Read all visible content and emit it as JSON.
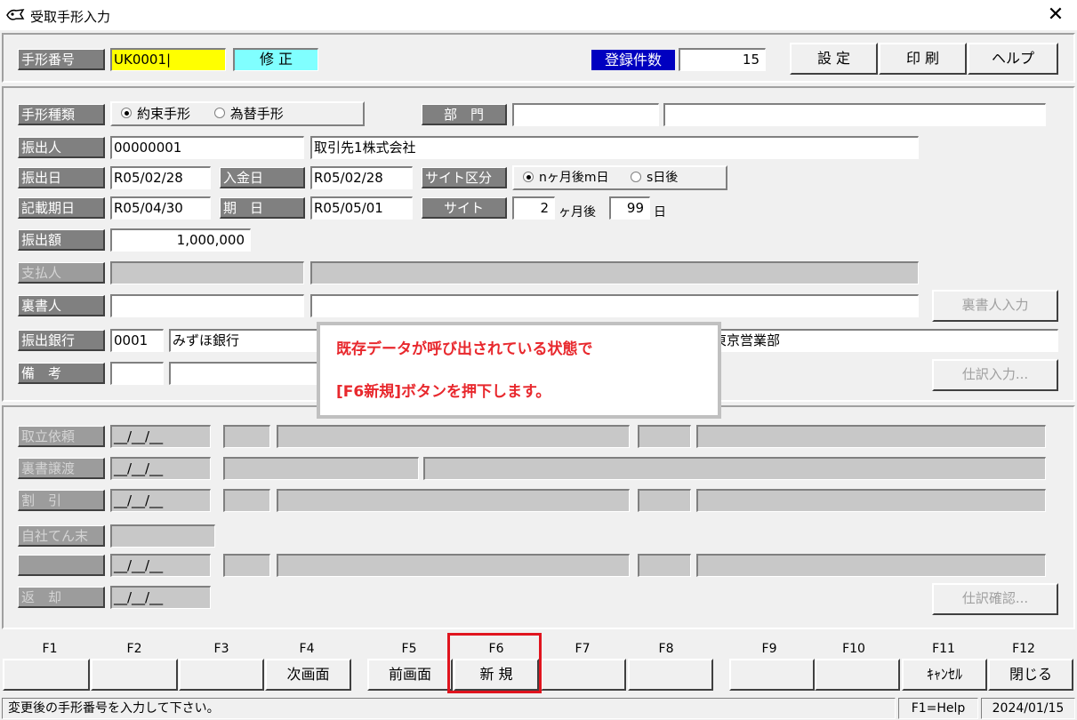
{
  "window": {
    "title": "受取手形入力",
    "icon": "app-icon",
    "close": "✕"
  },
  "header": {
    "note_no_label": "手形番号",
    "note_no_value": "UK0001|",
    "mode_badge": "修 正",
    "count_label": "登録件数",
    "count_value": "15",
    "buttons": {
      "settings": "設 定",
      "print": "印 刷",
      "help": "ヘルプ"
    }
  },
  "form": {
    "type_label": "手形種類",
    "type_options": [
      "約束手形",
      "為替手形"
    ],
    "type_selected": "約束手形",
    "dept_label": "部　門",
    "dept_code": "",
    "dept_name": "",
    "drawer_label": "振出人",
    "drawer_code": "00000001",
    "drawer_name": "取引先1株式会社",
    "issue_date_label": "振出日",
    "issue_date": "R05/02/28",
    "receipt_date_label": "入金日",
    "receipt_date": "R05/02/28",
    "site_type_label": "サイト区分",
    "site_options": [
      "nヶ月後m日",
      "s日後"
    ],
    "site_selected": "nヶ月後m日",
    "entry_date_label": "記載期日",
    "entry_date": "R05/04/30",
    "due_date_label": "期　日",
    "due_date": "R05/05/01",
    "site_label": "サイト",
    "site_months": "2",
    "site_months_unit": "ヶ月後",
    "site_days": "99",
    "site_days_unit": "日",
    "amount_label": "振出額",
    "amount": "1,000,000",
    "payer_label": "支払人",
    "endorser_label": "裏書人",
    "endorser_button": "裏書人入力",
    "bank_label": "振出銀行",
    "bank_code": "0001",
    "bank_name": "みずほ銀行",
    "branch_name": "東京営業部",
    "memo_label": "備　考",
    "journal_button": "仕訳入力..."
  },
  "lower": {
    "rows": [
      "取立依頼",
      "裏書譲渡",
      "割　引",
      "自社てん末",
      "",
      "返　却"
    ],
    "date_placeholder": "__/__/__",
    "journal_check_button": "仕訳確認..."
  },
  "annotation": {
    "line1": "既存データが呼び出されている状態で",
    "line2": "[F6新規]ボタンを押下します。",
    "color": "#e8282d"
  },
  "fkeys": [
    {
      "key": "F1",
      "label": ""
    },
    {
      "key": "F2",
      "label": ""
    },
    {
      "key": "F3",
      "label": ""
    },
    {
      "key": "F4",
      "label": "次画面"
    },
    {
      "key": "F5",
      "label": "前画面"
    },
    {
      "key": "F6",
      "label": "新 規"
    },
    {
      "key": "F7",
      "label": ""
    },
    {
      "key": "F8",
      "label": ""
    },
    {
      "key": "F9",
      "label": ""
    },
    {
      "key": "F10",
      "label": ""
    },
    {
      "key": "F11",
      "label": "ｷｬﾝｾﾙ"
    },
    {
      "key": "F12",
      "label": "閉じる"
    }
  ],
  "status": {
    "message": "変更後の手形番号を入力して下さい。",
    "help": "F1=Help",
    "date": "2024/01/15"
  }
}
